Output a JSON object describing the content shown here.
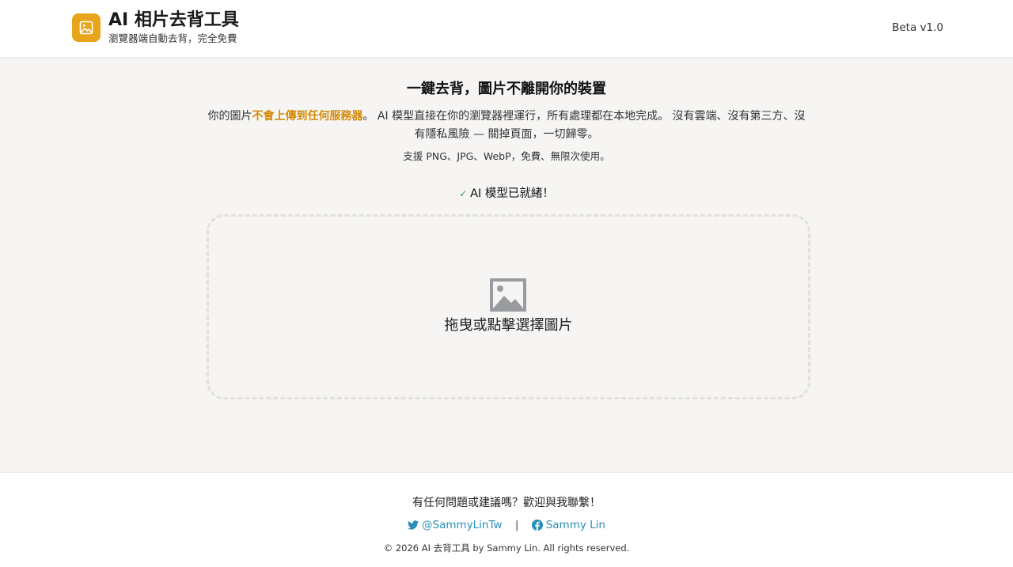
{
  "header": {
    "title": "AI 相片去背工具",
    "subtitle": "瀏覽器端自動去背，完全免費",
    "version": "Beta v1.0",
    "logo_icon": "image-icon",
    "brand_color": "#e8a51c"
  },
  "main": {
    "headline": "一鍵去背，圖片不離開你的裝置",
    "desc_part1": "你的圖片",
    "desc_highlight": "不會上傳到任何服務器",
    "desc_part2": "。 AI 模型直接在你的瀏覽器裡運行，所有處理都在本地完成。 沒有雲端、沒有第三方、沒有隱私風險 — 關掉頁面，一切歸零。",
    "highlight_color": "#d48a07",
    "support_text": "支援 PNG、JPG、WebP，免費、無限次使用。",
    "status_icon": "check-icon",
    "status_text": "AI 模型已就緒！",
    "dropzone_icon": "image-placeholder-icon",
    "dropzone_label": "拖曳或點擊選擇圖片"
  },
  "footer": {
    "question": "有任何問題或建議嗎？歡迎與我聯繫！",
    "twitter_label": "@SammyLinTw",
    "twitter_icon": "twitter-icon",
    "separator": "|",
    "facebook_label": "Sammy Lin",
    "facebook_icon": "facebook-icon",
    "copyright": "© 2026 AI 去背工具 by Sammy Lin. All rights reserved.",
    "link_color": "#2a8fb8"
  }
}
